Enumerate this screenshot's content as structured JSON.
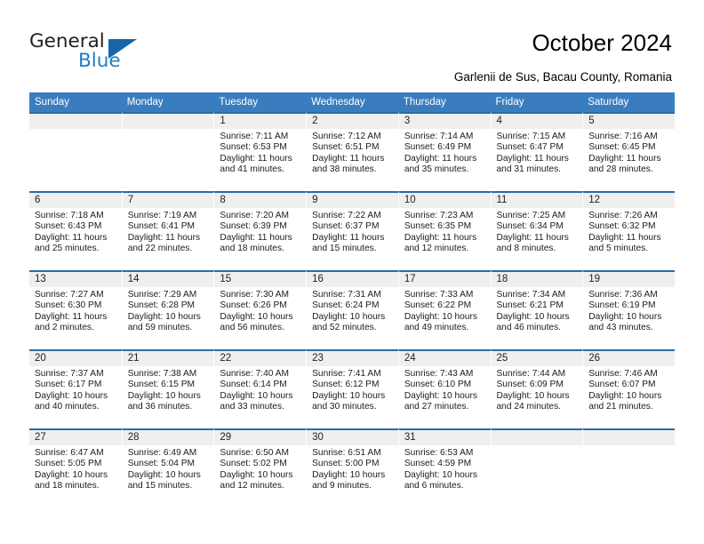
{
  "brand": {
    "name_top": "General",
    "name_bottom": "Blue",
    "accent_color": "#1f7dc4",
    "triangle_color": "#1565a8"
  },
  "header": {
    "title": "October 2024",
    "subtitle": "Garlenii de Sus, Bacau County, Romania"
  },
  "theme": {
    "header_row_bg": "#3a7dbf",
    "row_divider": "#2b6ba8",
    "daynum_bg": "#efefef",
    "text": "#1c1c1c"
  },
  "weekday_headers": [
    "Sunday",
    "Monday",
    "Tuesday",
    "Wednesday",
    "Thursday",
    "Friday",
    "Saturday"
  ],
  "labels": {
    "sunrise_prefix": "Sunrise:",
    "sunset_prefix": "Sunset:",
    "daylight_prefix": "Daylight:"
  },
  "weeks": [
    [
      {
        "day": "",
        "empty": true
      },
      {
        "day": "",
        "empty": true
      },
      {
        "day": "1",
        "line1": "Sunrise: 7:11 AM",
        "line2": "Sunset: 6:53 PM",
        "line3": "Daylight: 11 hours",
        "line4": "and 41 minutes."
      },
      {
        "day": "2",
        "line1": "Sunrise: 7:12 AM",
        "line2": "Sunset: 6:51 PM",
        "line3": "Daylight: 11 hours",
        "line4": "and 38 minutes."
      },
      {
        "day": "3",
        "line1": "Sunrise: 7:14 AM",
        "line2": "Sunset: 6:49 PM",
        "line3": "Daylight: 11 hours",
        "line4": "and 35 minutes."
      },
      {
        "day": "4",
        "line1": "Sunrise: 7:15 AM",
        "line2": "Sunset: 6:47 PM",
        "line3": "Daylight: 11 hours",
        "line4": "and 31 minutes."
      },
      {
        "day": "5",
        "line1": "Sunrise: 7:16 AM",
        "line2": "Sunset: 6:45 PM",
        "line3": "Daylight: 11 hours",
        "line4": "and 28 minutes."
      }
    ],
    [
      {
        "day": "6",
        "line1": "Sunrise: 7:18 AM",
        "line2": "Sunset: 6:43 PM",
        "line3": "Daylight: 11 hours",
        "line4": "and 25 minutes."
      },
      {
        "day": "7",
        "line1": "Sunrise: 7:19 AM",
        "line2": "Sunset: 6:41 PM",
        "line3": "Daylight: 11 hours",
        "line4": "and 22 minutes."
      },
      {
        "day": "8",
        "line1": "Sunrise: 7:20 AM",
        "line2": "Sunset: 6:39 PM",
        "line3": "Daylight: 11 hours",
        "line4": "and 18 minutes."
      },
      {
        "day": "9",
        "line1": "Sunrise: 7:22 AM",
        "line2": "Sunset: 6:37 PM",
        "line3": "Daylight: 11 hours",
        "line4": "and 15 minutes."
      },
      {
        "day": "10",
        "line1": "Sunrise: 7:23 AM",
        "line2": "Sunset: 6:35 PM",
        "line3": "Daylight: 11 hours",
        "line4": "and 12 minutes."
      },
      {
        "day": "11",
        "line1": "Sunrise: 7:25 AM",
        "line2": "Sunset: 6:34 PM",
        "line3": "Daylight: 11 hours",
        "line4": "and 8 minutes."
      },
      {
        "day": "12",
        "line1": "Sunrise: 7:26 AM",
        "line2": "Sunset: 6:32 PM",
        "line3": "Daylight: 11 hours",
        "line4": "and 5 minutes."
      }
    ],
    [
      {
        "day": "13",
        "line1": "Sunrise: 7:27 AM",
        "line2": "Sunset: 6:30 PM",
        "line3": "Daylight: 11 hours",
        "line4": "and 2 minutes."
      },
      {
        "day": "14",
        "line1": "Sunrise: 7:29 AM",
        "line2": "Sunset: 6:28 PM",
        "line3": "Daylight: 10 hours",
        "line4": "and 59 minutes."
      },
      {
        "day": "15",
        "line1": "Sunrise: 7:30 AM",
        "line2": "Sunset: 6:26 PM",
        "line3": "Daylight: 10 hours",
        "line4": "and 56 minutes."
      },
      {
        "day": "16",
        "line1": "Sunrise: 7:31 AM",
        "line2": "Sunset: 6:24 PM",
        "line3": "Daylight: 10 hours",
        "line4": "and 52 minutes."
      },
      {
        "day": "17",
        "line1": "Sunrise: 7:33 AM",
        "line2": "Sunset: 6:22 PM",
        "line3": "Daylight: 10 hours",
        "line4": "and 49 minutes."
      },
      {
        "day": "18",
        "line1": "Sunrise: 7:34 AM",
        "line2": "Sunset: 6:21 PM",
        "line3": "Daylight: 10 hours",
        "line4": "and 46 minutes."
      },
      {
        "day": "19",
        "line1": "Sunrise: 7:36 AM",
        "line2": "Sunset: 6:19 PM",
        "line3": "Daylight: 10 hours",
        "line4": "and 43 minutes."
      }
    ],
    [
      {
        "day": "20",
        "line1": "Sunrise: 7:37 AM",
        "line2": "Sunset: 6:17 PM",
        "line3": "Daylight: 10 hours",
        "line4": "and 40 minutes."
      },
      {
        "day": "21",
        "line1": "Sunrise: 7:38 AM",
        "line2": "Sunset: 6:15 PM",
        "line3": "Daylight: 10 hours",
        "line4": "and 36 minutes."
      },
      {
        "day": "22",
        "line1": "Sunrise: 7:40 AM",
        "line2": "Sunset: 6:14 PM",
        "line3": "Daylight: 10 hours",
        "line4": "and 33 minutes."
      },
      {
        "day": "23",
        "line1": "Sunrise: 7:41 AM",
        "line2": "Sunset: 6:12 PM",
        "line3": "Daylight: 10 hours",
        "line4": "and 30 minutes."
      },
      {
        "day": "24",
        "line1": "Sunrise: 7:43 AM",
        "line2": "Sunset: 6:10 PM",
        "line3": "Daylight: 10 hours",
        "line4": "and 27 minutes."
      },
      {
        "day": "25",
        "line1": "Sunrise: 7:44 AM",
        "line2": "Sunset: 6:09 PM",
        "line3": "Daylight: 10 hours",
        "line4": "and 24 minutes."
      },
      {
        "day": "26",
        "line1": "Sunrise: 7:46 AM",
        "line2": "Sunset: 6:07 PM",
        "line3": "Daylight: 10 hours",
        "line4": "and 21 minutes."
      }
    ],
    [
      {
        "day": "27",
        "line1": "Sunrise: 6:47 AM",
        "line2": "Sunset: 5:05 PM",
        "line3": "Daylight: 10 hours",
        "line4": "and 18 minutes."
      },
      {
        "day": "28",
        "line1": "Sunrise: 6:49 AM",
        "line2": "Sunset: 5:04 PM",
        "line3": "Daylight: 10 hours",
        "line4": "and 15 minutes."
      },
      {
        "day": "29",
        "line1": "Sunrise: 6:50 AM",
        "line2": "Sunset: 5:02 PM",
        "line3": "Daylight: 10 hours",
        "line4": "and 12 minutes."
      },
      {
        "day": "30",
        "line1": "Sunrise: 6:51 AM",
        "line2": "Sunset: 5:00 PM",
        "line3": "Daylight: 10 hours",
        "line4": "and 9 minutes."
      },
      {
        "day": "31",
        "line1": "Sunrise: 6:53 AM",
        "line2": "Sunset: 4:59 PM",
        "line3": "Daylight: 10 hours",
        "line4": "and 6 minutes."
      },
      {
        "day": "",
        "empty": true
      },
      {
        "day": "",
        "empty": true
      }
    ]
  ]
}
